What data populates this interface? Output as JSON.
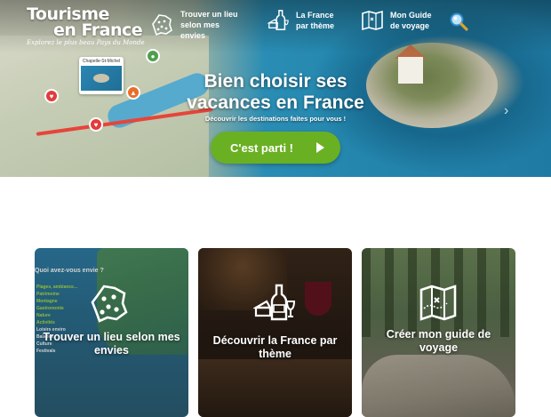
{
  "header": {
    "logo_line1": "Tourisme",
    "logo_line2": "en France",
    "logo_tagline": "Explorez le plus beau Pays du Monde",
    "nav": [
      {
        "label": "Trouver un lieu selon mes envies",
        "icon": "france-map-icon"
      },
      {
        "label": "La France par thème",
        "icon": "wine-cheese-icon"
      },
      {
        "label": "Mon Guide de voyage",
        "icon": "folded-map-icon"
      }
    ],
    "search_icon": "search-icon"
  },
  "hero": {
    "title_line1": "Bien choisir ses",
    "title_line2": "vacances en France",
    "subtitle": "Découvrir les destinations faites pour vous !",
    "cta_label": "C'est parti !",
    "map_card_label": "Chapelle-St-Michel",
    "next_arrow": "›"
  },
  "cards": [
    {
      "title": "Trouver un lieu selon mes envies",
      "icon": "france-map-icon",
      "preview_question": "Quoi avez-vous envie ?",
      "preview_lines": [
        "Plages, ambiance...",
        "Patrimoine",
        "Montagne",
        "Gastronomie",
        "Nature",
        "Activités",
        "Loisirs enviro",
        "Balades",
        "Culture",
        "Festivals"
      ]
    },
    {
      "title": "Découvrir la France par thème",
      "icon": "wine-cheese-icon"
    },
    {
      "title": "Créer mon guide de voyage",
      "icon": "folded-map-icon"
    }
  ],
  "colors": {
    "cta": "#6ab023",
    "pin": "#e23b3b",
    "text": "#ffffff"
  }
}
